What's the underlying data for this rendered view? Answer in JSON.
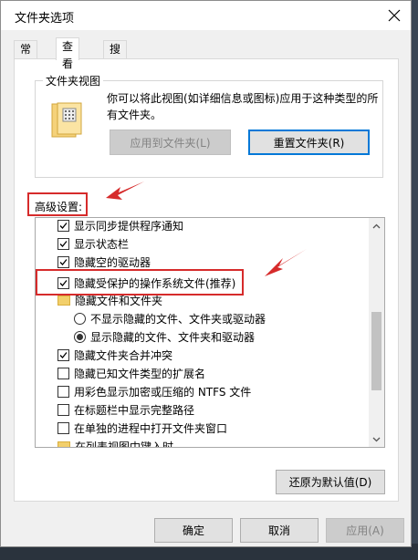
{
  "window": {
    "title": "文件夹选项"
  },
  "tabs": [
    {
      "label": "常规"
    },
    {
      "label": "查看"
    },
    {
      "label": "搜索"
    }
  ],
  "folder_view": {
    "legend": "文件夹视图",
    "description": "你可以将此视图(如详细信息或图标)应用于这种类型的所有文件夹。",
    "apply_button": "应用到文件夹(L)",
    "reset_button": "重置文件夹(R)"
  },
  "advanced": {
    "label": "高级设置:",
    "items": [
      {
        "type": "checkbox",
        "checked": true,
        "label": "显示同步提供程序通知"
      },
      {
        "type": "checkbox",
        "checked": true,
        "label": "显示状态栏"
      },
      {
        "type": "checkbox",
        "checked": true,
        "label": "隐藏空的驱动器"
      },
      {
        "type": "checkbox",
        "checked": true,
        "label": "隐藏受保护的操作系统文件(推荐)"
      },
      {
        "type": "folder",
        "label": "隐藏文件和文件夹"
      },
      {
        "type": "radio",
        "checked": false,
        "label": "不显示隐藏的文件、文件夹或驱动器"
      },
      {
        "type": "radio",
        "checked": true,
        "label": "显示隐藏的文件、文件夹和驱动器"
      },
      {
        "type": "checkbox",
        "checked": true,
        "label": "隐藏文件夹合并冲突"
      },
      {
        "type": "checkbox",
        "checked": false,
        "label": "隐藏已知文件类型的扩展名"
      },
      {
        "type": "checkbox",
        "checked": false,
        "label": "用彩色显示加密或压缩的 NTFS 文件"
      },
      {
        "type": "checkbox",
        "checked": false,
        "label": "在标题栏中显示完整路径"
      },
      {
        "type": "checkbox",
        "checked": false,
        "label": "在单独的进程中打开文件夹窗口"
      },
      {
        "type": "folder",
        "label": "在列表视图中键入时"
      }
    ],
    "restore_defaults_button": "还原为默认值(D)"
  },
  "footer": {
    "ok_button": "确定",
    "cancel_button": "取消",
    "apply_button": "应用(A)"
  },
  "colors": {
    "highlight_red": "#d62b2b",
    "focus_blue": "#0078d7"
  }
}
